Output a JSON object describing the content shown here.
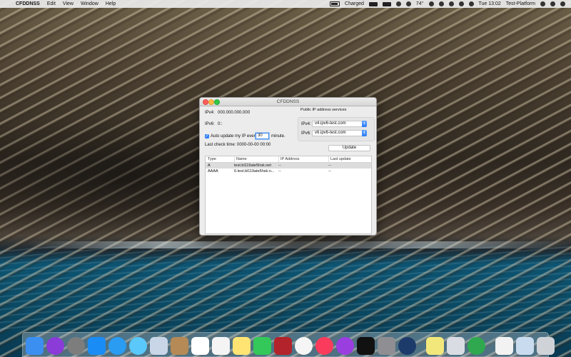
{
  "menubar": {
    "apple": "",
    "app_name": "CFDDNSS",
    "menus": [
      "Edit",
      "View",
      "Window",
      "Help"
    ],
    "battery_status": "Charged",
    "temperature": "74°",
    "clock": "Tue 13:02",
    "user": "Test-Platform"
  },
  "window": {
    "title": "CFDDNSS",
    "ipv4_label": "IPv4:",
    "ipv4_value": "000.000.000.000",
    "ipv6_label": "IPv6:",
    "ipv6_value": "0::",
    "auto_update_label": "Auto update my IP every",
    "auto_update_checked": true,
    "minutes_value": "30",
    "minute_label": "minute.",
    "last_check_label": "Last check time:",
    "last_check_value": "0000-00-00 00:00",
    "services_title": "Public IP address services",
    "ipv4_service_label": "IPv4:",
    "ipv4_service_value": "v4.ipv6-test.com",
    "ipv6_service_label": "IPv6:",
    "ipv6_service_value": "v6.ipv6-test.com",
    "update_button": "Update",
    "table": {
      "headers": [
        "Type",
        "Name",
        "IP Address",
        "Last update"
      ],
      "rows": [
        {
          "type": "A",
          "name": "test.bl119ate5hsk.net",
          "ip": "--",
          "last": "--"
        },
        {
          "type": "AAAA",
          "name": "6.test.bl119ate5hsk.n...",
          "ip": "--",
          "last": "--"
        }
      ]
    },
    "add_button": "+",
    "remove_button": "−"
  },
  "dock": {
    "items": [
      {
        "name": "finder-icon",
        "color": "#3b8ff0"
      },
      {
        "name": "siri-icon",
        "color": "#8a3bd8"
      },
      {
        "name": "launchpad-icon",
        "color": "#7d7d7d"
      },
      {
        "name": "app-store-icon",
        "color": "#1a8cf5"
      },
      {
        "name": "safari-icon",
        "color": "#2a9cf2"
      },
      {
        "name": "messages-icon",
        "color": "#5ac8fa"
      },
      {
        "name": "photo-viewer-icon",
        "color": "#c9d6e8"
      },
      {
        "name": "contacts-icon",
        "color": "#b58a56"
      },
      {
        "name": "calendar-icon",
        "color": "#ffffff"
      },
      {
        "name": "reminders-icon",
        "color": "#f4f4f4"
      },
      {
        "name": "notes-icon",
        "color": "#ffe474"
      },
      {
        "name": "facetime-icon",
        "color": "#34c759"
      },
      {
        "name": "photo-booth-icon",
        "color": "#b3232b"
      },
      {
        "name": "photos-icon",
        "color": "#f5f5f5"
      },
      {
        "name": "music-icon",
        "color": "#fb3b5c"
      },
      {
        "name": "podcasts-icon",
        "color": "#9a3ee0"
      },
      {
        "name": "tv-icon",
        "color": "#111111"
      },
      {
        "name": "system-preferences-icon",
        "color": "#8e8e93"
      },
      {
        "name": "speedometer-icon",
        "color": "#1c3b6b"
      },
      {
        "name": "stickies-icon",
        "color": "#f2e77a"
      },
      {
        "name": "preview-icon",
        "color": "#d9dde3"
      },
      {
        "name": "network-globe-icon",
        "color": "#2fa84f"
      },
      {
        "name": "document-icon",
        "color": "#f2f2f2"
      },
      {
        "name": "folder-stack-icon",
        "color": "#c9dcef"
      },
      {
        "name": "trash-icon",
        "color": "#cfd3d8"
      }
    ]
  }
}
